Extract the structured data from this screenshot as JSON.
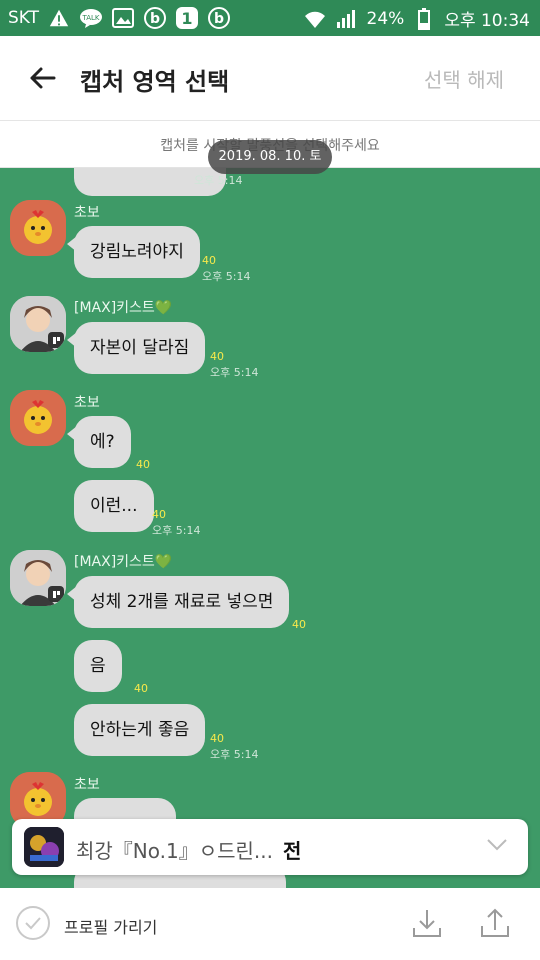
{
  "status": {
    "carrier": "SKT",
    "battery": "24%",
    "clock": "오후 10:34",
    "icons": [
      "warning-icon",
      "talk-icon",
      "gallery-icon",
      "b-icon",
      "one-icon",
      "b-icon",
      "wifi-icon",
      "signal-icon",
      "battery-icon"
    ]
  },
  "header": {
    "title": "캡처 영역 선택",
    "deselect": "선택 해제",
    "guide": "캡처를 시작할 말풍선을 선택해주세요",
    "date_chip": "2019. 08. 10. 토"
  },
  "messages": [
    {
      "type": "bubble",
      "text": "",
      "read": "",
      "time": "오후 5:14",
      "sender": "other"
    },
    {
      "type": "name",
      "text": "초보"
    },
    {
      "type": "bubble",
      "text": "강림노려야지",
      "read": "40",
      "time": "오후 5:14"
    },
    {
      "type": "name",
      "text": "[MAX]키스트💚"
    },
    {
      "type": "bubble",
      "text": "자본이 달라짐",
      "read": "40",
      "time": "오후 5:14"
    },
    {
      "type": "name",
      "text": "초보"
    },
    {
      "type": "bubble",
      "text": "에?",
      "read": "40",
      "time": ""
    },
    {
      "type": "bubble",
      "text": "이런...",
      "read": "40",
      "time": "오후 5:14"
    },
    {
      "type": "name",
      "text": "[MAX]키스트💚"
    },
    {
      "type": "bubble",
      "text": "성체 2개를 재료로 넣으면",
      "read": "40",
      "time": ""
    },
    {
      "type": "bubble",
      "text": "음",
      "read": "40",
      "time": ""
    },
    {
      "type": "bubble",
      "text": "안하는게 좋음",
      "read": "40",
      "time": "오후 5:14"
    },
    {
      "type": "name",
      "text": "초보"
    }
  ],
  "overlay": {
    "text": "최강『No.1』ㅇ드린...",
    "bold": "전"
  },
  "bottom": {
    "profile_label": "프로필 가리기"
  },
  "colors": {
    "chat_bg": "#3e9a67",
    "status_bg": "#2f8a57",
    "bubble": "#dedede",
    "read_count": "#f7e94b"
  }
}
